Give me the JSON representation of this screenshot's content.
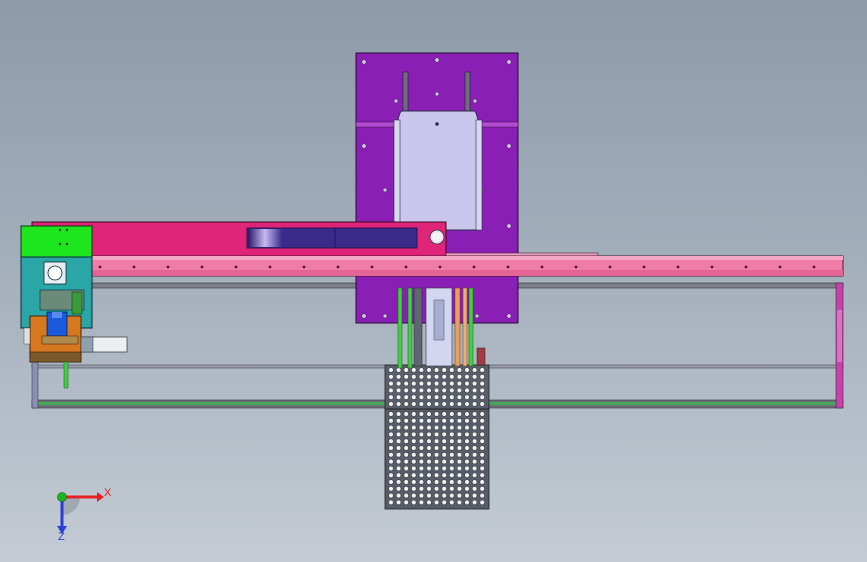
{
  "viewport": {
    "background_top": "#8d9aa8",
    "background_bottom": "#c4cbd4"
  },
  "triad": {
    "x_label": "X",
    "z_label": "Z",
    "x_color": "#e8202a",
    "y_color": "#19b41e",
    "z_color": "#2a3cd8"
  },
  "colors": {
    "vertical_plate": "#8a1fb6",
    "cover": "#c9c7ec",
    "beam_top": "#e0247a",
    "rail": "#f07ca8",
    "green_block": "#1ee61e",
    "orange_block": "#d5781f",
    "teal_block": "#2aa6a6",
    "frame": "#c93fae",
    "perforated_block": "#4e5560"
  }
}
